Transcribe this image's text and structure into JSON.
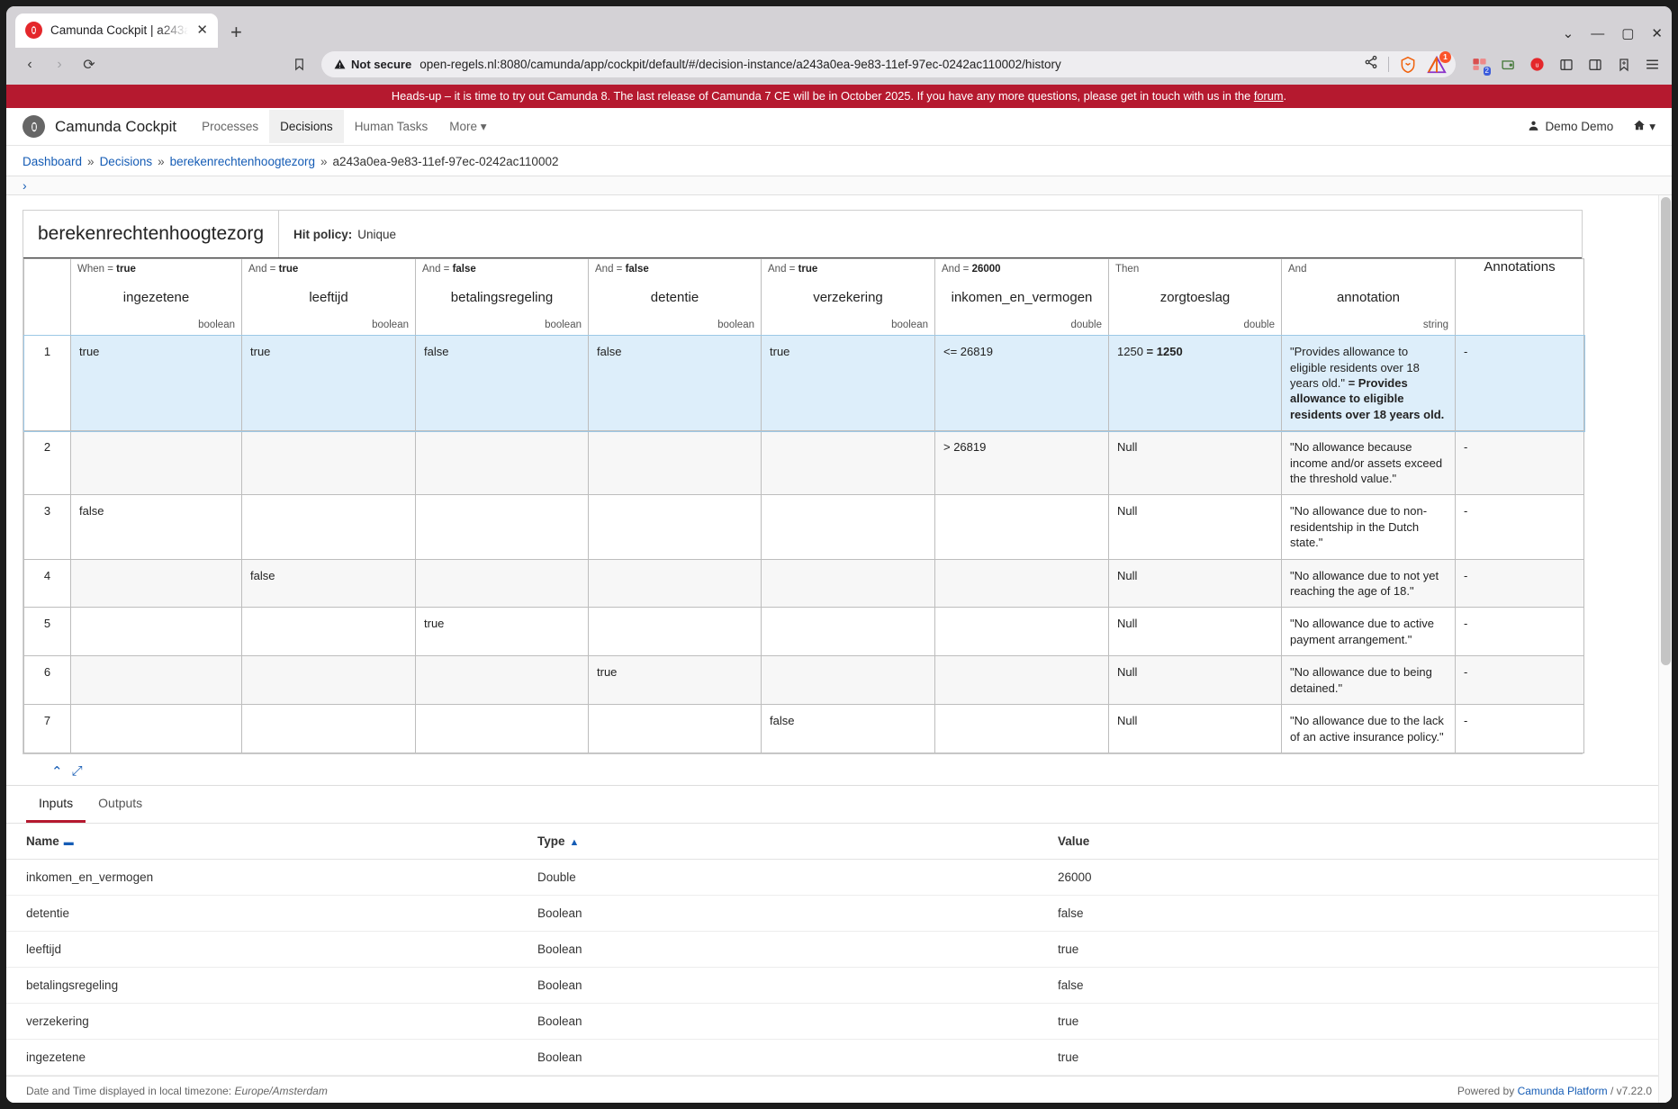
{
  "browser": {
    "tab": {
      "title": "Camunda Cockpit | a243a",
      "favicon": "camunda-favicon",
      "close": "✕"
    },
    "newtab_label": "+",
    "window_controls": {
      "minimize": "—",
      "maximize": "▢",
      "close": "✕",
      "expand": "⌄"
    },
    "nav": {
      "back": "‹",
      "forward": "›",
      "reload": "⟳",
      "bookmark": "bookmark-icon"
    },
    "url": {
      "security_label": "Not secure",
      "address": "open-regels.nl:8080/camunda/app/cockpit/default/#/decision-instance/a243a0ea-9e83-11ef-97ec-0242ac110002/history",
      "share_icon": "share-icon",
      "brave_shields_icon": "brave-lion-icon",
      "brave_rewards_icon": "brave-triangle-icon",
      "brave_rewards_count": "1"
    },
    "toolbar_icons": [
      "extension-icon",
      "wallet-icon",
      "brave-vpn-icon",
      "sidebar-toggle-icon",
      "split-view-icon",
      "bookmark-star-icon",
      "menu-icon"
    ],
    "extension_badge": "2"
  },
  "banner": {
    "text_before": "Heads-up – it is time to try out Camunda 8. The last release of Camunda 7 CE will be in October 2025. If you have any more questions, please get in touch with us in the ",
    "link": "forum",
    "text_after": ".",
    "color": "#b5192f"
  },
  "header": {
    "brand": "Camunda Cockpit",
    "nav": [
      {
        "label": "Processes",
        "active": false
      },
      {
        "label": "Decisions",
        "active": true
      },
      {
        "label": "Human Tasks",
        "active": false
      },
      {
        "label": "More",
        "active": false,
        "caret": "▾"
      }
    ],
    "user": "Demo Demo",
    "user_icon": "user-icon",
    "home_icon": "home-icon",
    "home_caret": "▾"
  },
  "breadcrumb": {
    "items": [
      {
        "label": "Dashboard",
        "link": true
      },
      {
        "label": "Decisions",
        "link": true
      },
      {
        "label": "berekenrechtenhoogtezorg",
        "link": true
      },
      {
        "label": "a243a0ea-9e83-11ef-97ec-0242ac110002",
        "link": false
      }
    ],
    "separator": "»"
  },
  "collapse_strip": {
    "chevron": "›"
  },
  "decision_table": {
    "name": "berekenrechtenhoogtezorg",
    "hit_policy_label": "Hit policy:",
    "hit_policy_value": "Unique",
    "annotations_header": "Annotations",
    "columns": [
      {
        "expr_prefix": "When =",
        "expr_value": "true",
        "name": "ingezetene",
        "type": "boolean"
      },
      {
        "expr_prefix": "And =",
        "expr_value": "true",
        "name": "leeftijd",
        "type": "boolean"
      },
      {
        "expr_prefix": "And =",
        "expr_value": "false",
        "name": "betalingsregeling",
        "type": "boolean"
      },
      {
        "expr_prefix": "And =",
        "expr_value": "false",
        "name": "detentie",
        "type": "boolean"
      },
      {
        "expr_prefix": "And =",
        "expr_value": "true",
        "name": "verzekering",
        "type": "boolean"
      },
      {
        "expr_prefix": "And =",
        "expr_value": "26000",
        "name": "inkomen_en_vermogen",
        "type": "double"
      },
      {
        "expr_prefix": "Then",
        "expr_value": "",
        "name": "zorgtoeslag",
        "type": "double"
      },
      {
        "expr_prefix": "And",
        "expr_value": "",
        "name": "annotation",
        "type": "string"
      }
    ],
    "rows": [
      {
        "index": "1",
        "highlighted": true,
        "cells": [
          "true",
          "true",
          "false",
          "false",
          "true",
          "<= 26819"
        ],
        "output": {
          "plain": "1250 ",
          "bold": "= 1250"
        },
        "annotation": {
          "plain": "\"Provides allowance to eligible residents over 18 years old.\" ",
          "bold": "= Provides allowance to eligible residents over 18 years old."
        },
        "annotations_col": "-"
      },
      {
        "index": "2",
        "highlighted": false,
        "cells": [
          "",
          "",
          "",
          "",
          "",
          "> 26819"
        ],
        "output": {
          "plain": "Null",
          "bold": ""
        },
        "annotation": {
          "plain": "\"No allowance because income and/or assets exceed the threshold value.\"",
          "bold": ""
        },
        "annotations_col": "-"
      },
      {
        "index": "3",
        "highlighted": false,
        "cells": [
          "false",
          "",
          "",
          "",
          "",
          ""
        ],
        "output": {
          "plain": "Null",
          "bold": ""
        },
        "annotation": {
          "plain": "\"No allowance due to non-residentship in the Dutch state.\"",
          "bold": ""
        },
        "annotations_col": "-"
      },
      {
        "index": "4",
        "highlighted": false,
        "cells": [
          "",
          "false",
          "",
          "",
          "",
          ""
        ],
        "output": {
          "plain": "Null",
          "bold": ""
        },
        "annotation": {
          "plain": "\"No allowance due to not yet reaching the age of 18.\"",
          "bold": ""
        },
        "annotations_col": "-"
      },
      {
        "index": "5",
        "highlighted": false,
        "cells": [
          "",
          "",
          "true",
          "",
          "",
          ""
        ],
        "output": {
          "plain": "Null",
          "bold": ""
        },
        "annotation": {
          "plain": "\"No allowance due to active payment arrangement.\"",
          "bold": ""
        },
        "annotations_col": "-"
      },
      {
        "index": "6",
        "highlighted": false,
        "cells": [
          "",
          "",
          "",
          "true",
          "",
          ""
        ],
        "output": {
          "plain": "Null",
          "bold": ""
        },
        "annotation": {
          "plain": "\"No allowance due to being detained.\"",
          "bold": ""
        },
        "annotations_col": "-"
      },
      {
        "index": "7",
        "highlighted": false,
        "cells": [
          "",
          "",
          "",
          "",
          "false",
          ""
        ],
        "output": {
          "plain": "Null",
          "bold": ""
        },
        "annotation": {
          "plain": "\"No allowance due to the lack of an active insurance policy.\"",
          "bold": ""
        },
        "annotations_col": "-"
      }
    ],
    "tools": {
      "collapse": "⌃",
      "expand": "⤢"
    }
  },
  "bottom": {
    "tabs": [
      {
        "label": "Inputs",
        "active": true
      },
      {
        "label": "Outputs",
        "active": false
      }
    ],
    "columns": [
      "Name",
      "Type",
      "Value"
    ],
    "sort_name_icon": "▬",
    "sort_type_icon": "▲",
    "rows": [
      {
        "name": "inkomen_en_vermogen",
        "type": "Double",
        "value": "26000"
      },
      {
        "name": "detentie",
        "type": "Boolean",
        "value": "false"
      },
      {
        "name": "leeftijd",
        "type": "Boolean",
        "value": "true"
      },
      {
        "name": "betalingsregeling",
        "type": "Boolean",
        "value": "false"
      },
      {
        "name": "verzekering",
        "type": "Boolean",
        "value": "true"
      },
      {
        "name": "ingezetene",
        "type": "Boolean",
        "value": "true"
      }
    ]
  },
  "footer": {
    "tz_prefix": "Date and Time displayed in local timezone:",
    "tz_value": "Europe/Amsterdam",
    "powered_prefix": "Powered by",
    "powered_link": "Camunda Platform",
    "version": "/ v7.22.0"
  }
}
